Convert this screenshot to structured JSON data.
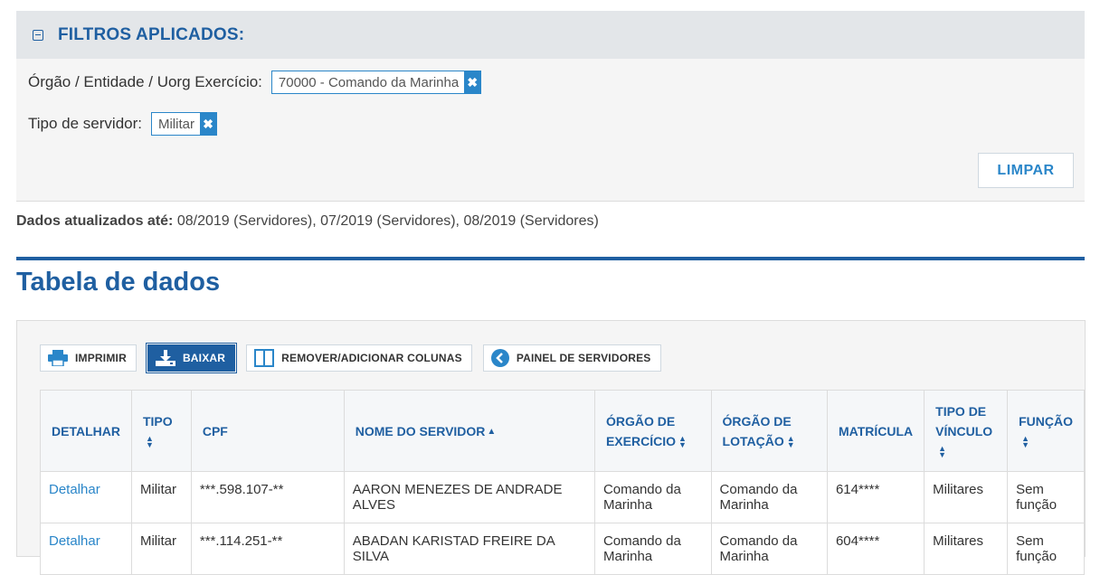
{
  "filters": {
    "title": "FILTROS APLICADOS:",
    "items": [
      {
        "label": "Órgão / Entidade / Uorg Exercício:",
        "value": "70000 - Comando da Marinha"
      },
      {
        "label": "Tipo de servidor:",
        "value": "Militar"
      }
    ],
    "clear_label": "LIMPAR"
  },
  "updated": {
    "label": "Dados atualizados até:",
    "value": "08/2019 (Servidores), 07/2019 (Servidores), 08/2019 (Servidores)"
  },
  "section_title": "Tabela de dados",
  "toolbar": {
    "print_label": "IMPRIMIR",
    "download_label": "BAIXAR",
    "columns_label": "REMOVER/ADICIONAR COLUNAS",
    "panel_label": "PAINEL DE SERVIDORES"
  },
  "table": {
    "headers": {
      "detalhar": "DETALHAR",
      "tipo": "TIPO",
      "cpf": "CPF",
      "nome": "NOME DO SERVIDOR",
      "orgao_exercicio_1": "ÓRGÃO DE",
      "orgao_exercicio_2": "EXERCÍCIO",
      "orgao_lotacao_1": "ÓRGÃO DE",
      "orgao_lotacao_2": "LOTAÇÃO",
      "matricula": "MATRÍCULA",
      "tipo_vinculo_1": "TIPO DE",
      "tipo_vinculo_2": "VÍNCULO",
      "funcao": "FUNÇÃO"
    },
    "rows": [
      {
        "detalhar": "Detalhar",
        "tipo": "Militar",
        "cpf": "***.598.107-**",
        "nome": "AARON MENEZES DE ANDRADE ALVES",
        "orgao_exercicio": "Comando da Marinha",
        "orgao_lotacao": "Comando da Marinha",
        "matricula": "614****",
        "tipo_vinculo": "Militares",
        "funcao": "Sem função"
      },
      {
        "detalhar": "Detalhar",
        "tipo": "Militar",
        "cpf": "***.114.251-**",
        "nome": "ABADAN KARISTAD FREIRE DA SILVA",
        "orgao_exercicio": "Comando da Marinha",
        "orgao_lotacao": "Comando da Marinha",
        "matricula": "604****",
        "tipo_vinculo": "Militares",
        "funcao": "Sem função"
      }
    ]
  }
}
